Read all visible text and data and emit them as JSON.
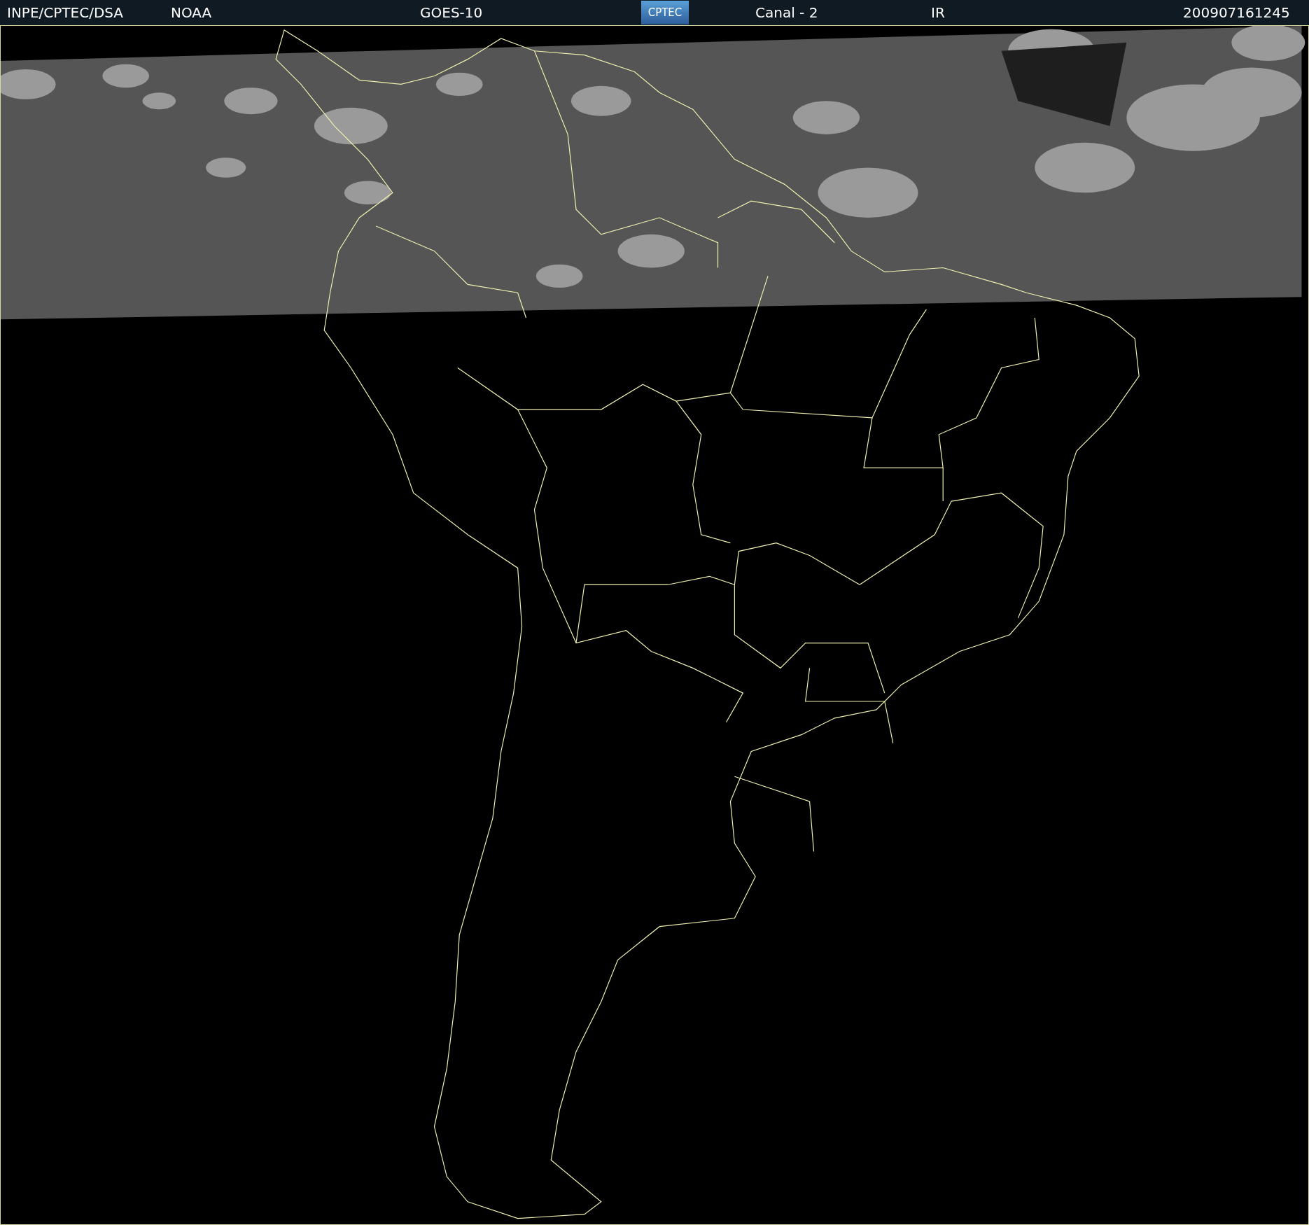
{
  "header": {
    "source": "INPE/CPTEC/DSA",
    "agency": "NOAA",
    "satellite": "GOES-10",
    "logo": "CPTEC",
    "channel": "Canal - 2",
    "band": "IR",
    "timestamp": "200907161245"
  }
}
